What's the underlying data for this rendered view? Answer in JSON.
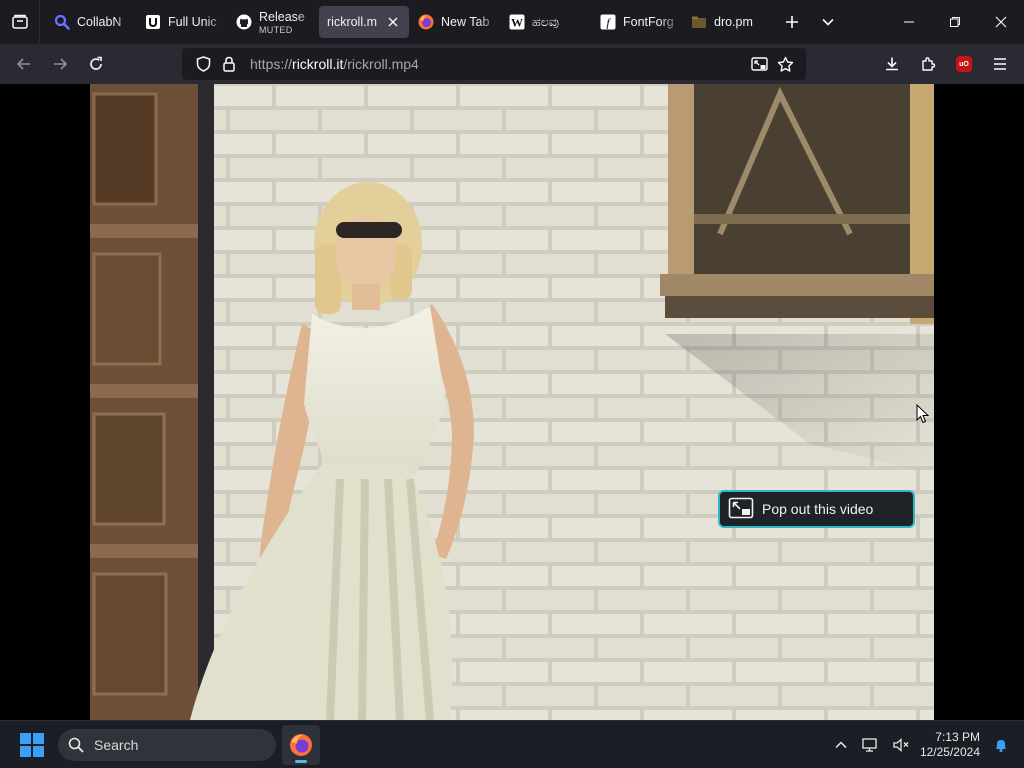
{
  "tabs": [
    {
      "title": "CollabN",
      "favicon": "search-icon"
    },
    {
      "title": "Full Unic",
      "favicon": "unicode-icon"
    },
    {
      "title": "Release",
      "subtitle": "MUTED",
      "favicon": "github-icon"
    },
    {
      "title": "rickroll.m",
      "favicon": "none",
      "active": true
    },
    {
      "title": "New Tab",
      "favicon": "firefox-icon"
    },
    {
      "title": "ಹಲವು",
      "favicon": "wikipedia-icon"
    },
    {
      "title": "FontForg",
      "favicon": "fontforge-icon"
    },
    {
      "title": "dro.pm",
      "favicon": "dropm-icon"
    }
  ],
  "urlbar": {
    "scheme": "https://",
    "host": "rickroll.it",
    "path": "/rickroll.mp4"
  },
  "video": {
    "pip_label": "Pop out this video"
  },
  "taskbar": {
    "search_label": "Search",
    "time": "7:13 PM",
    "date": "12/25/2024"
  },
  "colors": {
    "tab_strip": "#1c1b22",
    "nav_bar": "#2b2a33",
    "pip_border": "#31b6c4",
    "taskbar": "#1a1e25",
    "windows_blue": "#3aa0f3"
  }
}
